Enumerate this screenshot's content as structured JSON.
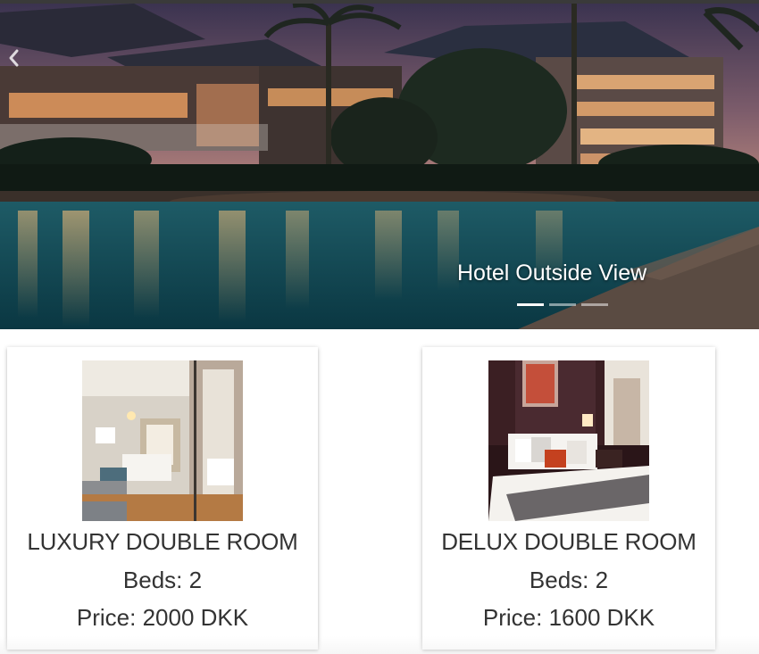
{
  "carousel": {
    "slide_caption": "Hotel Outside View",
    "indicator_count": 3,
    "active_indicator": 0,
    "prev_icon": "chevron-left-icon"
  },
  "rooms": [
    {
      "title": "LUXURY DOUBLE ROOM",
      "beds": "Beds: 2",
      "price": "Price: 2000 DKK"
    },
    {
      "title": "DELUX DOUBLE ROOM",
      "beds": "Beds: 2",
      "price": "Price: 1600 DKK"
    }
  ],
  "colors": {
    "card_background": "#ffffff",
    "text": "#333333",
    "caption_text": "#ffffff",
    "pool_water": "#0f4a56",
    "dusk_sky": "#6a4f5f",
    "lights": "#f2a45a"
  }
}
